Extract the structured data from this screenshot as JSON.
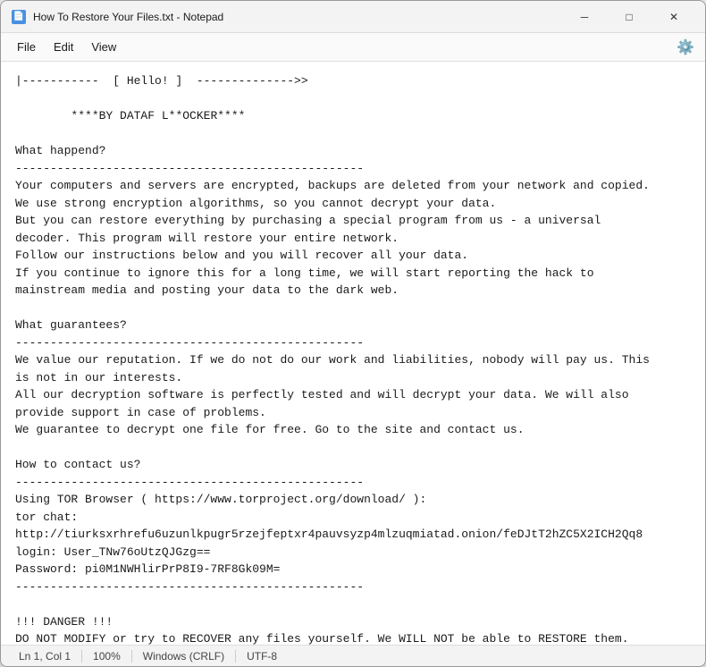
{
  "window": {
    "title": "How To Restore Your Files.txt - Notepad",
    "icon_char": "📝"
  },
  "title_bar": {
    "minimize_label": "─",
    "maximize_label": "□",
    "close_label": "✕"
  },
  "menu": {
    "file_label": "File",
    "edit_label": "Edit",
    "view_label": "View"
  },
  "status_bar": {
    "position": "Ln 1, Col 1",
    "zoom": "100%",
    "line_ending": "Windows (CRLF)",
    "encoding": "UTF-8"
  },
  "content": "|-----------  [ Hello! ]  -------------->>\n\n        ****BY DATAF L**OCKER****\n\nWhat happend?\n--------------------------------------------------\nYour computers and servers are encrypted, backups are deleted from your network and copied.\nWe use strong encryption algorithms, so you cannot decrypt your data.\nBut you can restore everything by purchasing a special program from us - a universal\ndecoder. This program will restore your entire network.\nFollow our instructions below and you will recover all your data.\nIf you continue to ignore this for a long time, we will start reporting the hack to\nmainstream media and posting your data to the dark web.\n\nWhat guarantees?\n--------------------------------------------------\nWe value our reputation. If we do not do our work and liabilities, nobody will pay us. This\nis not in our interests.\nAll our decryption software is perfectly tested and will decrypt your data. We will also\nprovide support in case of problems.\nWe guarantee to decrypt one file for free. Go to the site and contact us.\n\nHow to contact us?\n--------------------------------------------------\nUsing TOR Browser ( https://www.torproject.org/download/ ):\ntor chat:\nhttp://tiurksxrhrefu6uzunlkpugr5rzejfeptxr4pauvsyzp4mlzuqmiatad.onion/feDJtT2hZC5X2ICH2Qq8\nlogin: User_TNw76oUtzQJGzg==\nPassword: pi0M1NWHlirPrP8I9-7RF8Gk09M=\n--------------------------------------------------\n\n!!! DANGER !!!\nDO NOT MODIFY or try to RECOVER any files yourself. We WILL NOT be able to RESTORE them.\n!!! DANGER !!"
}
